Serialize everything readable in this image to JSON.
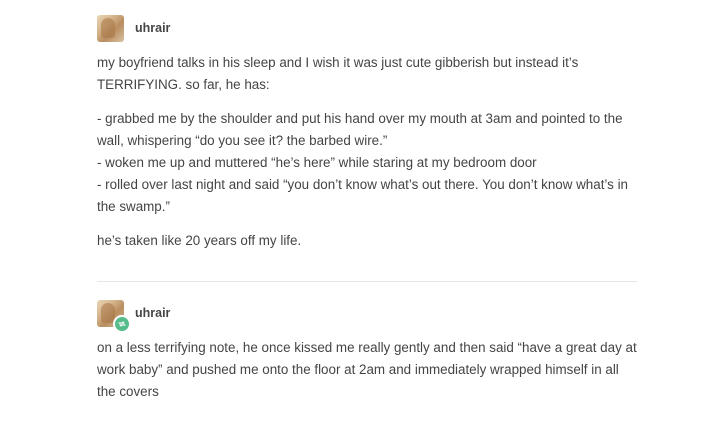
{
  "posts": [
    {
      "username": "uhrair",
      "intro": "my boyfriend talks in his sleep and I wish it was just cute gibberish but instead it’s TERRIFYING. so far, he has:",
      "items": [
        "- grabbed me by the shoulder and put his hand over my mouth at 3am and pointed to the wall, whispering “do you see it? the barbed wire.”",
        "- woken me up and muttered “he’s here” while staring at my bedroom door",
        "- rolled over last night and said “you don’t know what’s out there. You don’t know what’s in the swamp.”"
      ],
      "outro": "he’s taken like 20 years off my life."
    },
    {
      "username": "uhrair",
      "text": "on a less terrifying note, he once kissed me really gently and then said “have a great day at work baby” and pushed me onto the floor at 2am and immediately wrapped himself in all the covers"
    }
  ],
  "colors": {
    "text": "#444444",
    "reblog_badge": "#56bc8a",
    "divider": "#e6e6e6"
  },
  "icons": {
    "avatar": "user-avatar",
    "reblog": "reblog-icon"
  }
}
